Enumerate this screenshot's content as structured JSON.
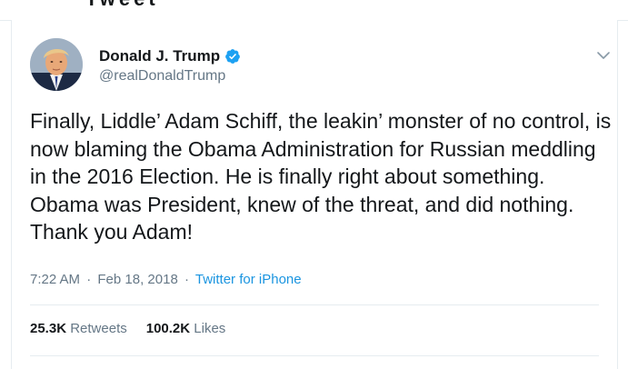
{
  "top_strip": {
    "partial_text": "Tweet"
  },
  "author": {
    "display_name": "Donald J. Trump",
    "handle": "@realDonaldTrump",
    "verified": true,
    "avatar_icon": "profile-photo",
    "verified_icon": "verified-badge-icon"
  },
  "tweet": {
    "text": "Finally, Liddle’ Adam Schiff, the leakin’ monster of no control, is now blaming the Obama Administration for Russian meddling in the 2016 Election. He is finally right about something. Obama was President, knew of the threat, and did nothing. Thank you Adam!"
  },
  "meta": {
    "time": "7:22 AM",
    "separator": "·",
    "date": "Feb 18, 2018",
    "source": "Twitter for iPhone"
  },
  "stats": {
    "retweets_value": "25.3K",
    "retweets_label": "Retweets",
    "likes_value": "100.2K",
    "likes_label": "Likes"
  },
  "colors": {
    "text": "#14171a",
    "secondary": "#657786",
    "link": "#1b95e0",
    "verified": "#1da1f2",
    "border": "#e6ecf0"
  }
}
